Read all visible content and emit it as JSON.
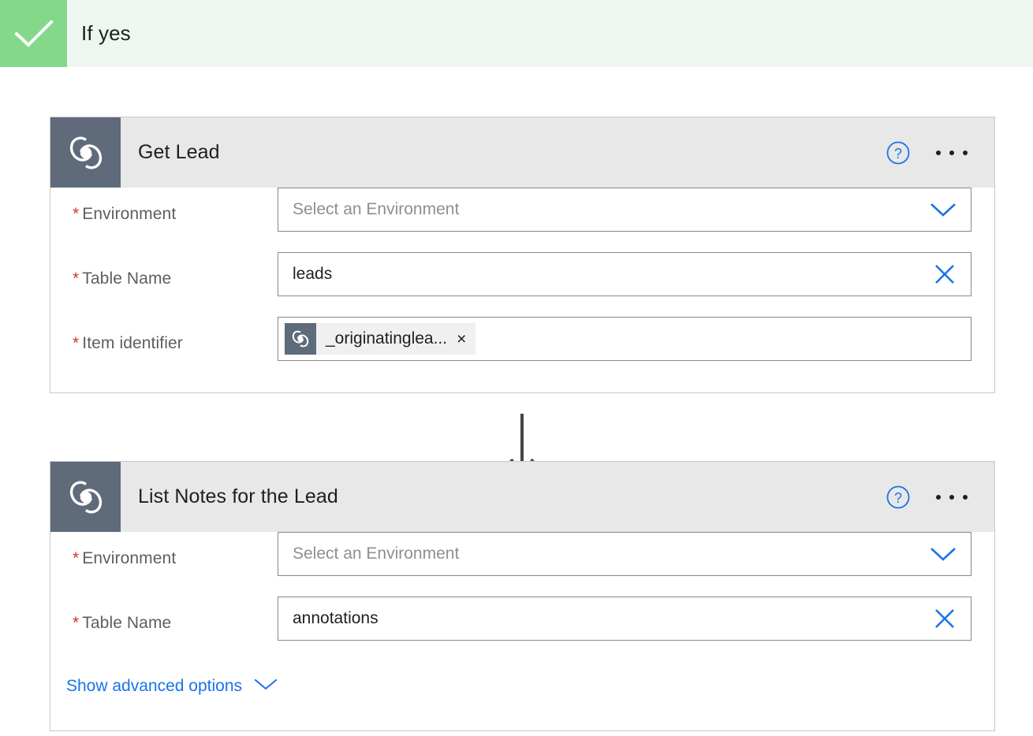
{
  "branch": {
    "title": "If yes",
    "icon": "check-icon",
    "icon_tile_color": "#84d88a",
    "band_color": "#eef7ef"
  },
  "theme": {
    "accent_blue": "#1a73e8",
    "link_blue": "#1a73e8",
    "required_red": "#d13438",
    "card_header_gray": "#e8e8e8",
    "connector_slate": "#5f6b7a",
    "card_border": "#c8c8c8",
    "input_border": "#8a8886"
  },
  "cards": [
    {
      "id": "get-lead",
      "title": "Get Lead",
      "icon": "dataverse-icon",
      "help_icon": "help-circle-icon",
      "more_icon": "ellipsis-icon",
      "fields": [
        {
          "label": "Environment",
          "required": true,
          "type": "dropdown",
          "value": "",
          "placeholder": "Select an Environment",
          "affix_icon": "chevron-down-icon"
        },
        {
          "label": "Table Name",
          "required": true,
          "type": "combobox",
          "value": "leads",
          "placeholder": "",
          "affix_icon": "close-x-icon"
        },
        {
          "label": "Item identifier",
          "required": true,
          "type": "token",
          "value": "",
          "placeholder": "",
          "token": {
            "icon": "dataverse-icon",
            "text": "_originatinglea...",
            "remove": "×"
          }
        }
      ]
    },
    {
      "id": "list-notes-for-the-lead",
      "title": "List Notes for the Lead",
      "icon": "dataverse-icon",
      "help_icon": "help-circle-icon",
      "more_icon": "ellipsis-icon",
      "fields": [
        {
          "label": "Environment",
          "required": true,
          "type": "dropdown",
          "value": "",
          "placeholder": "Select an Environment",
          "affix_icon": "chevron-down-icon"
        },
        {
          "label": "Table Name",
          "required": true,
          "type": "combobox",
          "value": "annotations",
          "placeholder": "",
          "affix_icon": "close-x-icon"
        }
      ],
      "advanced_options": {
        "label": "Show advanced options",
        "icon": "chevron-down-icon"
      }
    }
  ],
  "connector": {
    "icon": "down-arrow-icon"
  }
}
